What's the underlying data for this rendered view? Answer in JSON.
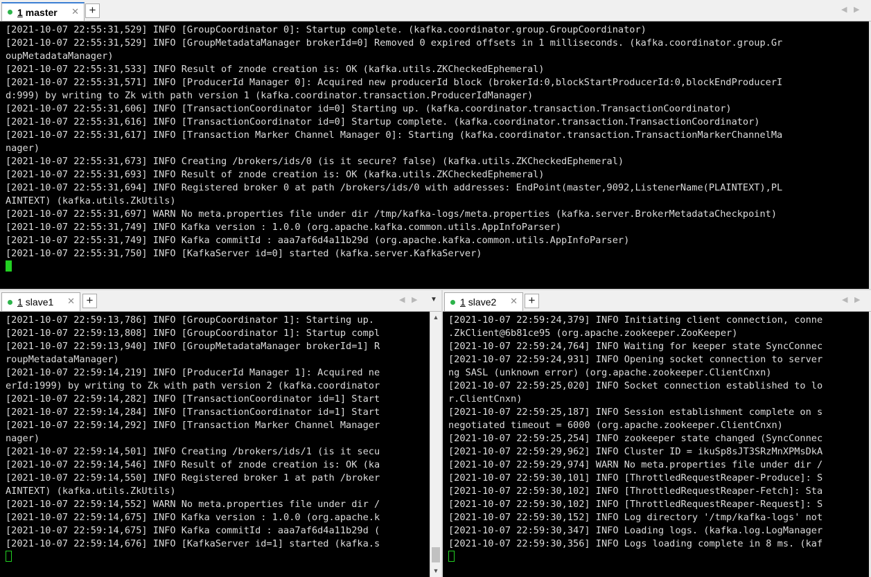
{
  "colors": {
    "accent": "#3b7fd4",
    "status_dot": "#2cb34a",
    "cursor": "#22d022",
    "terminal_bg": "#000000",
    "terminal_fg": "#dcdcdc"
  },
  "icons": {
    "add_tab": "+",
    "close": "✕",
    "nav_left": "◀",
    "nav_right": "▶",
    "dropdown": "▼",
    "scroll_up": "▲",
    "scroll_down": "▼"
  },
  "master": {
    "tab": {
      "number": "1",
      "name": "master"
    },
    "lines": [
      "[2021-10-07 22:55:31,529] INFO [GroupCoordinator 0]: Startup complete. (kafka.coordinator.group.GroupCoordinator)",
      "[2021-10-07 22:55:31,529] INFO [GroupMetadataManager brokerId=0] Removed 0 expired offsets in 1 milliseconds. (kafka.coordinator.group.Gr",
      "oupMetadataManager)",
      "[2021-10-07 22:55:31,533] INFO Result of znode creation is: OK (kafka.utils.ZKCheckedEphemeral)",
      "[2021-10-07 22:55:31,571] INFO [ProducerId Manager 0]: Acquired new producerId block (brokerId:0,blockStartProducerId:0,blockEndProducerI",
      "d:999) by writing to Zk with path version 1 (kafka.coordinator.transaction.ProducerIdManager)",
      "[2021-10-07 22:55:31,606] INFO [TransactionCoordinator id=0] Starting up. (kafka.coordinator.transaction.TransactionCoordinator)",
      "[2021-10-07 22:55:31,616] INFO [TransactionCoordinator id=0] Startup complete. (kafka.coordinator.transaction.TransactionCoordinator)",
      "[2021-10-07 22:55:31,617] INFO [Transaction Marker Channel Manager 0]: Starting (kafka.coordinator.transaction.TransactionMarkerChannelMa",
      "nager)",
      "[2021-10-07 22:55:31,673] INFO Creating /brokers/ids/0 (is it secure? false) (kafka.utils.ZKCheckedEphemeral)",
      "[2021-10-07 22:55:31,693] INFO Result of znode creation is: OK (kafka.utils.ZKCheckedEphemeral)",
      "[2021-10-07 22:55:31,694] INFO Registered broker 0 at path /brokers/ids/0 with addresses: EndPoint(master,9092,ListenerName(PLAINTEXT),PL",
      "AINTEXT) (kafka.utils.ZkUtils)",
      "[2021-10-07 22:55:31,697] WARN No meta.properties file under dir /tmp/kafka-logs/meta.properties (kafka.server.BrokerMetadataCheckpoint)",
      "[2021-10-07 22:55:31,749] INFO Kafka version : 1.0.0 (org.apache.kafka.common.utils.AppInfoParser)",
      "[2021-10-07 22:55:31,749] INFO Kafka commitId : aaa7af6d4a11b29d (org.apache.kafka.common.utils.AppInfoParser)",
      "[2021-10-07 22:55:31,750] INFO [KafkaServer id=0] started (kafka.server.KafkaServer)"
    ]
  },
  "slave1": {
    "tab": {
      "number": "1",
      "name": "slave1"
    },
    "lines": [
      "[2021-10-07 22:59:13,786] INFO [GroupCoordinator 1]: Starting up.",
      "[2021-10-07 22:59:13,808] INFO [GroupCoordinator 1]: Startup compl",
      "[2021-10-07 22:59:13,940] INFO [GroupMetadataManager brokerId=1] R",
      "roupMetadataManager)",
      "[2021-10-07 22:59:14,219] INFO [ProducerId Manager 1]: Acquired ne",
      "erId:1999) by writing to Zk with path version 2 (kafka.coordinator",
      "[2021-10-07 22:59:14,282] INFO [TransactionCoordinator id=1] Start",
      "[2021-10-07 22:59:14,284] INFO [TransactionCoordinator id=1] Start",
      "[2021-10-07 22:59:14,292] INFO [Transaction Marker Channel Manager",
      "nager)",
      "[2021-10-07 22:59:14,501] INFO Creating /brokers/ids/1 (is it secu",
      "[2021-10-07 22:59:14,546] INFO Result of znode creation is: OK (ka",
      "[2021-10-07 22:59:14,550] INFO Registered broker 1 at path /broker",
      "AINTEXT) (kafka.utils.ZkUtils)",
      "[2021-10-07 22:59:14,552] WARN No meta.properties file under dir /",
      "[2021-10-07 22:59:14,675] INFO Kafka version : 1.0.0 (org.apache.k",
      "[2021-10-07 22:59:14,675] INFO Kafka commitId : aaa7af6d4a11b29d (",
      "[2021-10-07 22:59:14,676] INFO [KafkaServer id=1] started (kafka.s"
    ]
  },
  "slave2": {
    "tab": {
      "number": "1",
      "name": "slave2"
    },
    "lines": [
      "[2021-10-07 22:59:24,379] INFO Initiating client connection, conne",
      ".ZkClient@6b81ce95 (org.apache.zookeeper.ZooKeeper)",
      "[2021-10-07 22:59:24,764] INFO Waiting for keeper state SyncConnec",
      "[2021-10-07 22:59:24,931] INFO Opening socket connection to server",
      "ng SASL (unknown error) (org.apache.zookeeper.ClientCnxn)",
      "[2021-10-07 22:59:25,020] INFO Socket connection established to lo",
      "r.ClientCnxn)",
      "[2021-10-07 22:59:25,187] INFO Session establishment complete on s",
      "negotiated timeout = 6000 (org.apache.zookeeper.ClientCnxn)",
      "[2021-10-07 22:59:25,254] INFO zookeeper state changed (SyncConnec",
      "[2021-10-07 22:59:29,962] INFO Cluster ID = ikuSp8sJT3SRzMnXPMsDkA",
      "[2021-10-07 22:59:29,974] WARN No meta.properties file under dir /",
      "[2021-10-07 22:59:30,101] INFO [ThrottledRequestReaper-Produce]: S",
      "[2021-10-07 22:59:30,102] INFO [ThrottledRequestReaper-Fetch]: Sta",
      "[2021-10-07 22:59:30,102] INFO [ThrottledRequestReaper-Request]: S",
      "[2021-10-07 22:59:30,152] INFO Log directory '/tmp/kafka-logs' not",
      "[2021-10-07 22:59:30,347] INFO Loading logs. (kafka.log.LogManager",
      "[2021-10-07 22:59:30,356] INFO Logs loading complete in 8 ms. (kaf"
    ]
  }
}
